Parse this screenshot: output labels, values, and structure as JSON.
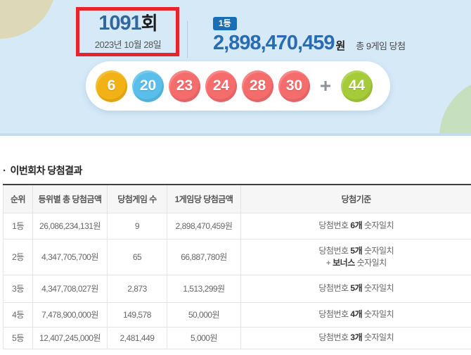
{
  "colors": {
    "hero_bg": "#d5e9f7",
    "hero_edge": "#c3dcee",
    "beige_circle": "#ddd9b8",
    "green_circle": "#c5dfbf",
    "draw_number_blue": "#33659e",
    "badge_blue": "#1a6eb5",
    "amount_blue": "#2a6cb2",
    "annotation_red": "#e7232d",
    "plus_gray": "#8e9399"
  },
  "hero": {
    "draw_no_num": "1091",
    "draw_no_suffix": "회",
    "draw_date": "2023년 10월 28일",
    "rank_badge": "1등",
    "prize_amount": "2,898,470,459",
    "prize_currency": "원",
    "prize_note": "총 9게임 당첨",
    "plus_sign": "+",
    "balls": [
      {
        "num": "6",
        "color": "#f2b115"
      },
      {
        "num": "20",
        "color": "#59bee9"
      },
      {
        "num": "23",
        "color": "#f56c6c"
      },
      {
        "num": "24",
        "color": "#f56c6c"
      },
      {
        "num": "28",
        "color": "#f56c6c"
      },
      {
        "num": "30",
        "color": "#f56c6c"
      },
      {
        "num": "44",
        "color": "#a5cb38"
      }
    ]
  },
  "results": {
    "bullet": "·",
    "section_title": "이번회차 당첨결과",
    "columns": [
      "순위",
      "등위별 총 당첨금액",
      "당첨게임 수",
      "1게임당 당첨금액",
      "당첨기준"
    ],
    "rows": [
      {
        "rank": "1등",
        "total": "26,086,234,131원",
        "games": "9",
        "per_game": "2,898,470,459원",
        "crit": {
          "pre": "당첨번호 ",
          "bold": "6개",
          "post": " 숫자일치"
        }
      },
      {
        "rank": "2등",
        "total": "4,347,705,700원",
        "games": "65",
        "per_game": "66,887,780원",
        "crit": {
          "pre": "당첨번호 ",
          "bold": "5개",
          "post": " 숫자일치"
        },
        "crit2": {
          "pre": "+ ",
          "bold": "보너스",
          "post": " 숫자일치"
        }
      },
      {
        "rank": "3등",
        "total": "4,347,708,027원",
        "games": "2,873",
        "per_game": "1,513,299원",
        "crit": {
          "pre": "당첨번호 ",
          "bold": "5개",
          "post": " 숫자일치"
        }
      },
      {
        "rank": "4등",
        "total": "7,478,900,000원",
        "games": "149,578",
        "per_game": "50,000원",
        "crit": {
          "pre": "당첨번호 ",
          "bold": "4개",
          "post": " 숫자일치"
        }
      },
      {
        "rank": "5등",
        "total": "12,407,245,000원",
        "games": "2,481,449",
        "per_game": "5,000원",
        "crit": {
          "pre": "당첨번호 ",
          "bold": "3개",
          "post": " 숫자일치"
        }
      }
    ]
  }
}
